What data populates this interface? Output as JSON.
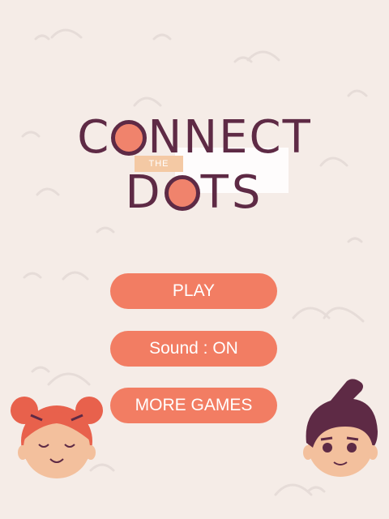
{
  "title": {
    "line1_pre": "C",
    "line1_post": "NNECT",
    "the_tag": "THE",
    "line2_pre": "D",
    "line2_post": "TS"
  },
  "menu": {
    "play_label": "PLAY",
    "sound_label": "Sound : ON",
    "more_games_label": "MORE GAMES"
  },
  "colors": {
    "background": "#f5ece7",
    "button": "#f27d63",
    "title": "#5e2a45",
    "dot": "#f0836c"
  },
  "characters": [
    "girl-character",
    "boy-character"
  ]
}
